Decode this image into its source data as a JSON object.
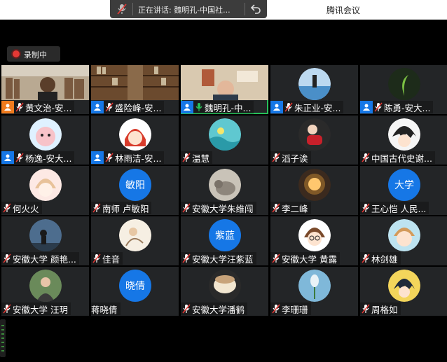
{
  "app": {
    "title": "腾讯会议"
  },
  "speaker": {
    "text": "正在讲话: 魏明孔-中国社..."
  },
  "recording": {
    "label": "录制中",
    "color": "#e53935"
  },
  "colors": {
    "host_badge": "#f07b1e",
    "cohost_badge": "#1677e6",
    "active_border": "#27c05a",
    "text_avatar": "#1677e6"
  },
  "tiles": [
    {
      "name": "黄文治-安...",
      "role": "host",
      "mic": "off",
      "media": "video",
      "media_theme": "library"
    },
    {
      "name": "盛险峰-安...",
      "role": "cohost",
      "mic": "off",
      "media": "video",
      "media_theme": "bookshelf"
    },
    {
      "name": "魏明孔-中...",
      "role": "cohost",
      "mic": "on",
      "media": "video",
      "media_theme": "office",
      "active": true
    },
    {
      "name": "朱正业-安...",
      "role": "cohost",
      "mic": "off",
      "media": "avatar",
      "avatar_theme": "sea"
    },
    {
      "name": "陈勇-安大...",
      "role": "cohost",
      "mic": "off",
      "media": "avatar",
      "avatar_theme": "plant"
    },
    {
      "name": "杨逸-安大...",
      "role": "cohost",
      "mic": "off",
      "media": "avatar",
      "avatar_theme": "cartoon-pink"
    },
    {
      "name": "林雨洁-安...",
      "role": "cohost",
      "mic": "off",
      "media": "avatar",
      "avatar_theme": "anime-girl"
    },
    {
      "name": "温慧",
      "role": "none",
      "mic": "off",
      "media": "avatar",
      "avatar_theme": "teal-water"
    },
    {
      "name": "滔子诶",
      "role": "none",
      "mic": "off",
      "media": "avatar",
      "avatar_theme": "guitar"
    },
    {
      "name": "中国古代史谢...",
      "role": "none",
      "mic": "off",
      "media": "avatar",
      "avatar_theme": "anime-boy"
    },
    {
      "name": "何火火",
      "role": "none",
      "mic": "off",
      "media": "avatar",
      "avatar_theme": "anime-cute"
    },
    {
      "name": "南师 卢敏阳",
      "role": "none",
      "mic": "off",
      "media": "text_avatar",
      "avatar_text": "敏阳"
    },
    {
      "name": "安徽大学朱维闯",
      "role": "none",
      "mic": "off",
      "media": "avatar",
      "avatar_theme": "cat"
    },
    {
      "name": "李二峰",
      "role": "none",
      "mic": "off",
      "media": "avatar",
      "avatar_theme": "lamp"
    },
    {
      "name": "王心恺  人民...",
      "role": "none",
      "mic": "off",
      "media": "text_avatar",
      "avatar_text": "大学"
    },
    {
      "name": "安徽大学 颜艳...",
      "role": "none",
      "mic": "off",
      "media": "avatar",
      "avatar_theme": "silhouette"
    },
    {
      "name": "佳音",
      "role": "none",
      "mic": "off",
      "media": "avatar",
      "avatar_theme": "sketch"
    },
    {
      "name": "安徽大学汪紫蓝",
      "role": "none",
      "mic": "off",
      "media": "text_avatar",
      "avatar_text": "紫蓝"
    },
    {
      "name": "安徽大学 黄露",
      "role": "none",
      "mic": "off",
      "media": "avatar",
      "avatar_theme": "anime-glasses"
    },
    {
      "name": "林剑雄",
      "role": "none",
      "mic": "off",
      "media": "avatar",
      "avatar_theme": "chibi"
    },
    {
      "name": "安徽大学 汪玥",
      "role": "none",
      "mic": "off",
      "media": "avatar",
      "avatar_theme": "photo-girl"
    },
    {
      "name": "蒋晓倩",
      "role": "none",
      "mic": "none",
      "media": "text_avatar",
      "avatar_text": "晓倩"
    },
    {
      "name": "安徽大学潘鹤",
      "role": "none",
      "mic": "off",
      "media": "avatar",
      "avatar_theme": "hamster"
    },
    {
      "name": "李珊珊",
      "role": "none",
      "mic": "off",
      "media": "avatar",
      "avatar_theme": "flower"
    },
    {
      "name": "周格如",
      "role": "none",
      "mic": "off",
      "media": "avatar",
      "avatar_theme": "anime-dark"
    }
  ]
}
